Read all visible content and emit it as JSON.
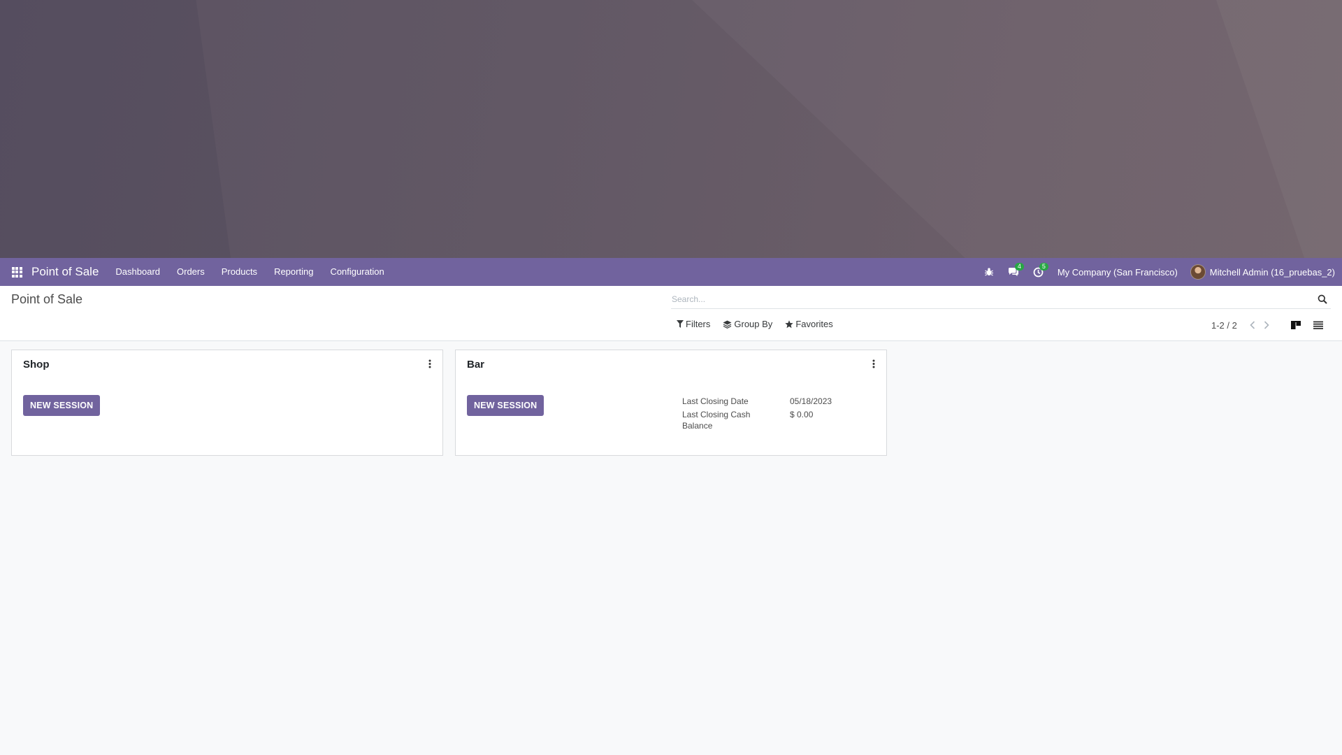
{
  "navbar": {
    "brand": "Point of Sale",
    "menu": [
      "Dashboard",
      "Orders",
      "Products",
      "Reporting",
      "Configuration"
    ],
    "messages_count": "4",
    "activities_count": "5",
    "company": "My Company (San Francisco)",
    "user": "Mitchell Admin (16_pruebas_2)"
  },
  "control_panel": {
    "title": "Point of Sale",
    "search_placeholder": "Search...",
    "filters_label": "Filters",
    "group_by_label": "Group By",
    "favorites_label": "Favorites",
    "pager": "1-2 / 2",
    "active_view": "kanban"
  },
  "cards": [
    {
      "name": "Shop",
      "button_label": "NEW SESSION"
    },
    {
      "name": "Bar",
      "button_label": "NEW SESSION",
      "last_closing_date_label": "Last Closing Date",
      "last_closing_date": "05/18/2023",
      "last_closing_cash_label": "Last Closing Cash Balance",
      "last_closing_cash": "$ 0.00"
    }
  ],
  "colors": {
    "brand": "#71639e",
    "badge": "#28a745"
  }
}
